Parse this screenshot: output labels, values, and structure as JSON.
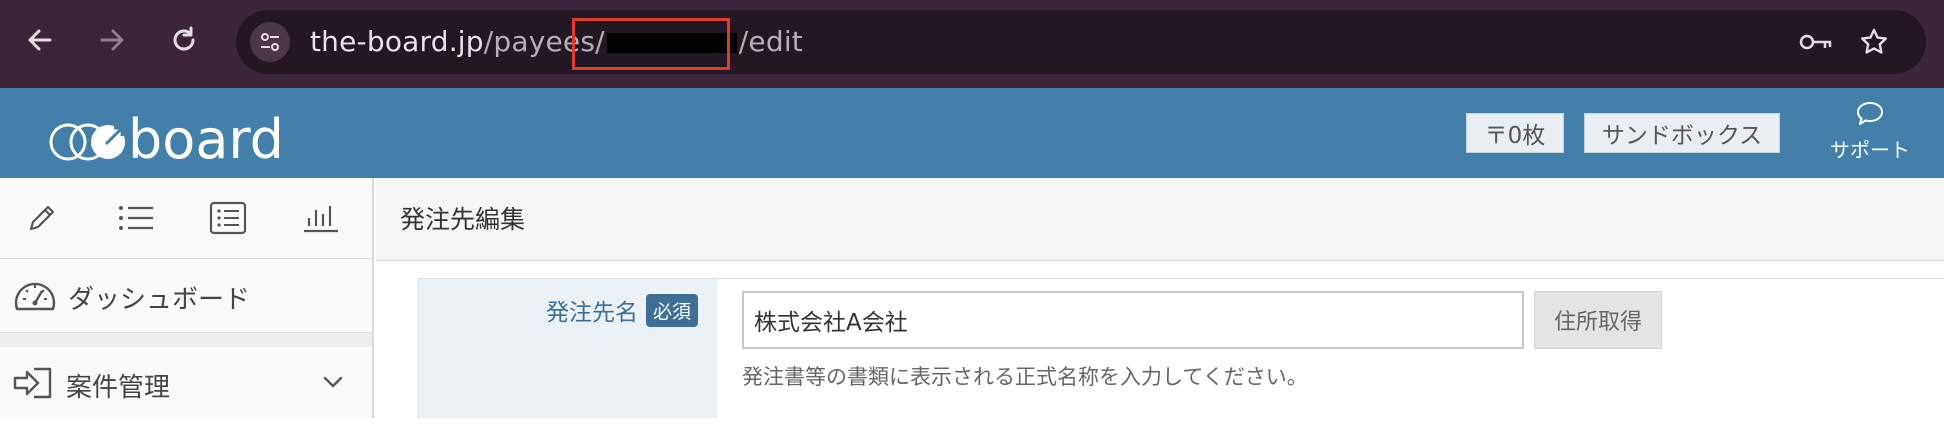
{
  "browser": {
    "url_host": "the-board.jp",
    "url_path_prefix": "/payees/",
    "url_path_suffix": "/edit",
    "icons": [
      "back-icon",
      "forward-icon",
      "reload-icon",
      "site-settings-icon",
      "key-icon",
      "bookmark-star-icon"
    ]
  },
  "header": {
    "logo_text": "board",
    "ticket_button": "〒0枚",
    "sandbox_button": "サンドボックス",
    "support_label": "サポート"
  },
  "sidebar": {
    "tab_icons": [
      "pencil-icon",
      "list-icon",
      "list-box-icon",
      "chart-icon"
    ],
    "items": [
      {
        "label": "ダッシュボード",
        "icon": "dashboard-gauge-icon"
      },
      {
        "label": "案件管理",
        "icon": "sign-in-icon",
        "chevron": "chevron-down-icon"
      }
    ]
  },
  "main": {
    "page_title": "発注先編集",
    "form": {
      "field_label": "発注先名",
      "required_badge": "必須",
      "field_value": "株式会社A会社",
      "address_button": "住所取得",
      "hint": "発注書等の書類に表示される正式名称を入力してください。"
    }
  },
  "colors": {
    "chrome_bg": "#3a2638",
    "header_bg": "#4280aa",
    "redaction_box": "#e03a2f",
    "required_badge": "#3f6e96"
  }
}
